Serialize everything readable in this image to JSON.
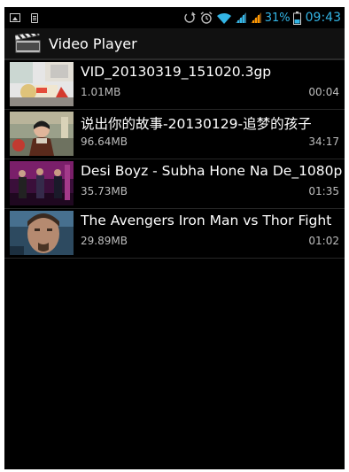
{
  "status_bar": {
    "battery_percent": "31%",
    "time": "09:43",
    "icons": [
      "picture-icon",
      "sd-card-icon",
      "sync-icon",
      "alarm-icon",
      "wifi-icon",
      "signal-icon",
      "signal-icon",
      "battery-icon"
    ],
    "accent_color": "#33b5e5"
  },
  "app": {
    "title": "Video Player",
    "icon": "clapperboard-icon"
  },
  "videos": [
    {
      "title": "VID_20130319_151020.3gp",
      "size": "1.01MB",
      "duration": "00:04"
    },
    {
      "title": "说出你的故事-20130129-追梦的孩子",
      "size": "96.64MB",
      "duration": "34:17"
    },
    {
      "title": "Desi Boyz - Subha Hone Na De_1080p",
      "size": "35.73MB",
      "duration": "01:35"
    },
    {
      "title": "The Avengers Iron Man vs Thor Fight",
      "size": "29.89MB",
      "duration": "01:02"
    }
  ]
}
